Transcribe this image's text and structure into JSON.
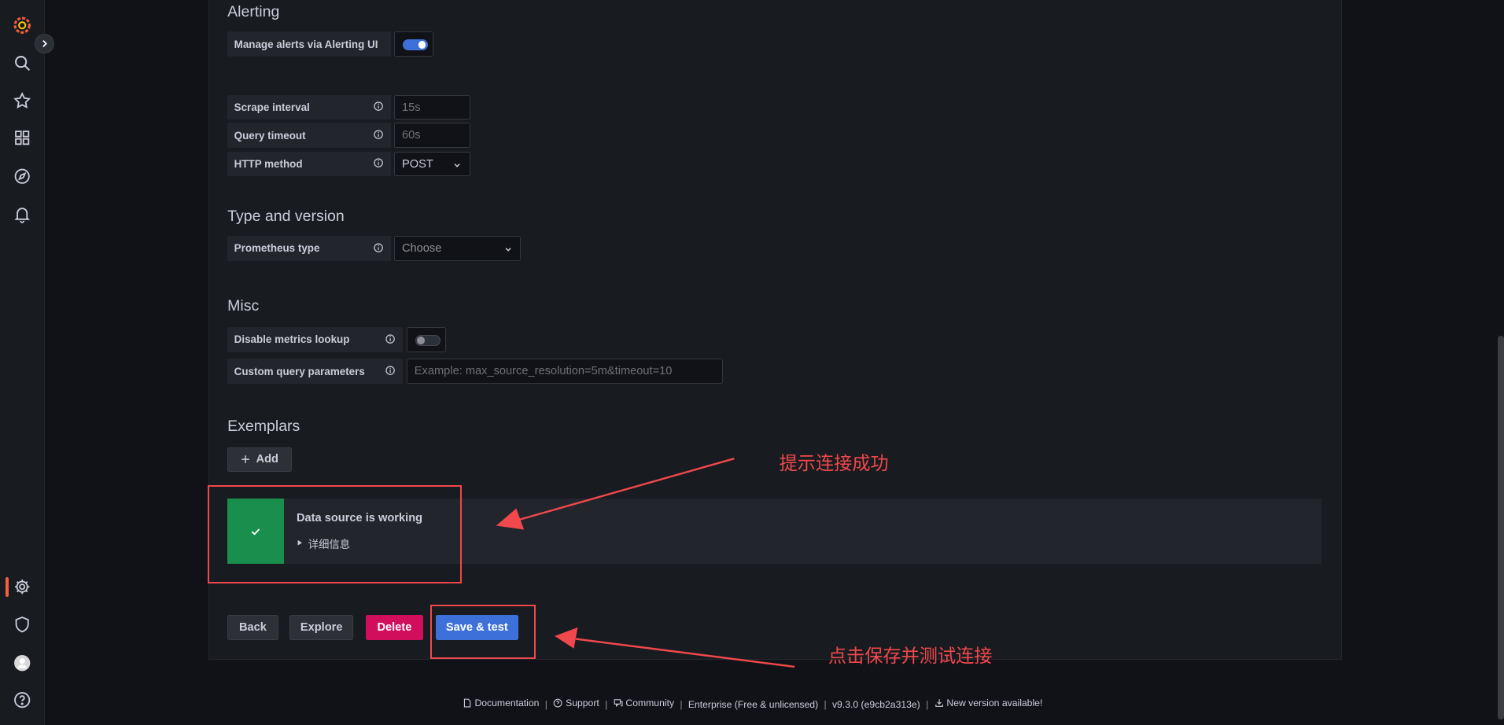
{
  "alerting": {
    "title": "Alerting",
    "manage_label": "Manage alerts via Alerting UI",
    "manage_enabled": true
  },
  "http": {
    "scrape_interval_label": "Scrape interval",
    "scrape_interval_placeholder": "15s",
    "query_timeout_label": "Query timeout",
    "query_timeout_placeholder": "60s",
    "http_method_label": "HTTP method",
    "http_method_value": "POST"
  },
  "type_version": {
    "title": "Type and version",
    "prometheus_type_label": "Prometheus type",
    "prometheus_type_value": "Choose"
  },
  "misc": {
    "title": "Misc",
    "disable_metrics_label": "Disable metrics lookup",
    "disable_metrics_enabled": false,
    "custom_query_label": "Custom query parameters",
    "custom_query_placeholder": "Example: max_source_resolution=5m&timeout=10"
  },
  "exemplars": {
    "title": "Exemplars",
    "add_label": "Add"
  },
  "status": {
    "title": "Data source is working",
    "details": "详细信息",
    "color": "#1a8f4d"
  },
  "actions": {
    "back": "Back",
    "explore": "Explore",
    "delete": "Delete",
    "save_test": "Save & test"
  },
  "annotations": {
    "success_note": "提示连接成功",
    "save_note": "点击保存并测试连接",
    "color": "#f0484c"
  },
  "footer": {
    "documentation": "Documentation",
    "support": "Support",
    "community": "Community",
    "edition": "Enterprise (Free & unlicensed)",
    "version": "v9.3.0 (e9cb2a313e)",
    "new_version": "New version available!"
  },
  "colors": {
    "primary": "#3d71d9",
    "danger": "#d10e5c",
    "brand": "#f55f3e"
  },
  "icons": [
    "grafana-logo-icon",
    "search-icon",
    "star-icon",
    "dashboards-icon",
    "explore-icon",
    "bell-icon",
    "gear-icon",
    "shield-icon",
    "avatar-icon",
    "help-icon"
  ]
}
